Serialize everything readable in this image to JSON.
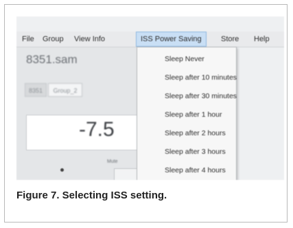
{
  "menubar": {
    "items": [
      {
        "label": "File"
      },
      {
        "label": "Group"
      },
      {
        "label": "View Info"
      },
      {
        "label": "ISS Power Saving"
      },
      {
        "label": "Store"
      },
      {
        "label": "Help"
      }
    ]
  },
  "dropdown": {
    "items": [
      {
        "label": "Sleep Never"
      },
      {
        "label": "Sleep after 10 minutes"
      },
      {
        "label": "Sleep after 30 minutes"
      },
      {
        "label": "Sleep after 1 hour"
      },
      {
        "label": "Sleep after 2 hours"
      },
      {
        "label": "Sleep after 3 hours"
      },
      {
        "label": "Sleep after 4 hours"
      }
    ]
  },
  "left_pane": {
    "file_title": "8351.sam",
    "tabs": [
      {
        "label": "8351"
      },
      {
        "label": "Group_2"
      }
    ],
    "value": "-7.5",
    "mute_label": "Mute"
  },
  "caption": "Figure 7. Selecting ISS setting."
}
